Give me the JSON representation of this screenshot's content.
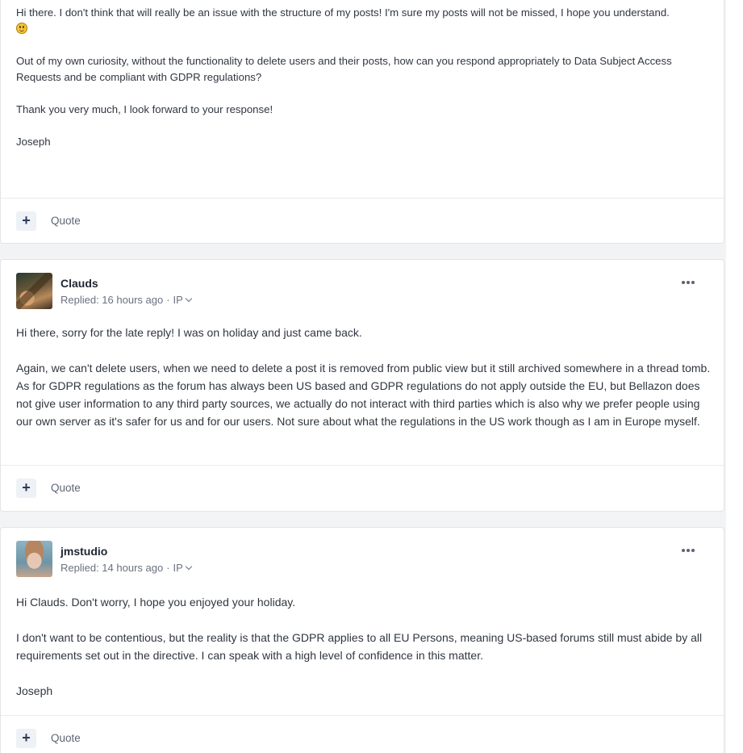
{
  "posts": [
    {
      "paragraphs": [
        "Hi there. I don't think that will really be an issue with the structure of my posts! I'm sure my posts will not be missed, I hope you understand.",
        "Out of my own curiosity, without the functionality to delete users and their posts, how can you respond appropriately to Data Subject Access Requests and be compliant with GDPR regulations?",
        "Thank you very much, I look forward to your response!",
        "Joseph"
      ],
      "emoji": "smiling-face",
      "footer": {
        "plus": "+",
        "quote": "Quote"
      }
    },
    {
      "author": "Clauds",
      "meta": {
        "replied": "Replied: 16 hours ago",
        "ip": "IP"
      },
      "paragraphs": [
        "Hi there, sorry for the late reply! I was on holiday and just came back.",
        "Again, we can't delete users, when we need to delete a post it is removed from public view but it still archived somewhere in a thread tomb. As for GDPR regulations as the forum has always been US based and GDPR regulations do not apply outside the EU, but Bellazon does not give user information to any third party sources, we actually do not interact with third parties which is also why we prefer people using our own server as it's safer for us and for our users. Not sure about what the regulations in the US work though as I am in Europe myself."
      ],
      "footer": {
        "plus": "+",
        "quote": "Quote"
      }
    },
    {
      "author": "jmstudio",
      "meta": {
        "replied": "Replied: 14 hours ago",
        "ip": "IP"
      },
      "paragraphs": [
        "Hi Clauds. Don't worry, I hope you enjoyed your holiday.",
        "I don't want to be contentious, but the reality is that the GDPR applies to all EU Persons, meaning US-based forums still must abide by all requirements set out in the directive. I can speak with a high level of confidence in this matter.",
        "Joseph"
      ],
      "footer": {
        "plus": "+",
        "quote": "Quote"
      }
    }
  ],
  "meta_separator": "·"
}
